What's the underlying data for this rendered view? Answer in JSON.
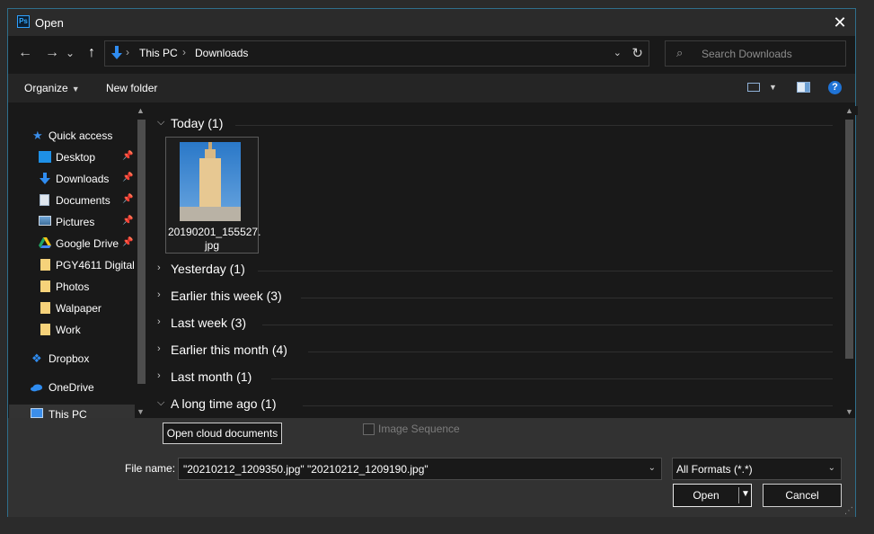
{
  "window": {
    "title": "Open",
    "app_icon": "Ps",
    "close_icon": "close-icon"
  },
  "nav_buttons": {
    "back": "←",
    "forward": "→",
    "recent": "⌄",
    "up": "↑"
  },
  "address": {
    "crumbs": [
      "This PC",
      "Downloads"
    ],
    "separator": "›",
    "refresh": "↻"
  },
  "search": {
    "placeholder": "Search Downloads"
  },
  "toolbar": {
    "organize": "Organize",
    "new_folder": "New folder",
    "help": "?"
  },
  "sidebar": {
    "items": [
      {
        "label": "Quick access",
        "icon": "star-icon",
        "pinned": false
      },
      {
        "label": "Desktop",
        "icon": "desktop-icon",
        "pinned": true
      },
      {
        "label": "Downloads",
        "icon": "download-arrow-icon",
        "pinned": true
      },
      {
        "label": "Documents",
        "icon": "document-icon",
        "pinned": true
      },
      {
        "label": "Pictures",
        "icon": "pictures-icon",
        "pinned": true
      },
      {
        "label": "Google Drive",
        "icon": "google-drive-icon",
        "pinned": true
      },
      {
        "label": "PGY4611 Digital",
        "icon": "folder-icon",
        "pinned": false
      },
      {
        "label": "Photos",
        "icon": "folder-icon",
        "pinned": false
      },
      {
        "label": "Walpaper",
        "icon": "folder-icon",
        "pinned": false
      },
      {
        "label": "Work",
        "icon": "folder-icon",
        "pinned": false
      },
      {
        "label": "Dropbox",
        "icon": "dropbox-icon",
        "pinned": false
      },
      {
        "label": "OneDrive",
        "icon": "cloud-icon",
        "pinned": false
      },
      {
        "label": "This PC",
        "icon": "computer-icon",
        "pinned": false,
        "selected": true
      }
    ]
  },
  "groups": [
    {
      "title": "Today (1)",
      "expanded": true
    },
    {
      "title": "Yesterday (1)",
      "expanded": false
    },
    {
      "title": "Earlier this week (3)",
      "expanded": false
    },
    {
      "title": "Last week (3)",
      "expanded": false
    },
    {
      "title": "Earlier this month (4)",
      "expanded": false
    },
    {
      "title": "Last month (1)",
      "expanded": false
    },
    {
      "title": "A long time ago (1)",
      "expanded": true
    }
  ],
  "file": {
    "name": "20190201_155527.jpg",
    "name_line1": "20190201_155527.",
    "name_line2": "jpg"
  },
  "bottom": {
    "cloud_button": "Open cloud documents",
    "image_sequence": "Image Sequence",
    "file_name_label": "File name:",
    "file_name_value": "\"20210212_1209350.jpg\" \"20210212_1209190.jpg\"",
    "format_value": "All Formats (*.*)",
    "open_button": "Open",
    "cancel_button": "Cancel"
  },
  "colors": {
    "background": "#191919",
    "titlebar": "#2b2b2b",
    "accent": "#1f73d6",
    "border": "#2f6f8c"
  }
}
